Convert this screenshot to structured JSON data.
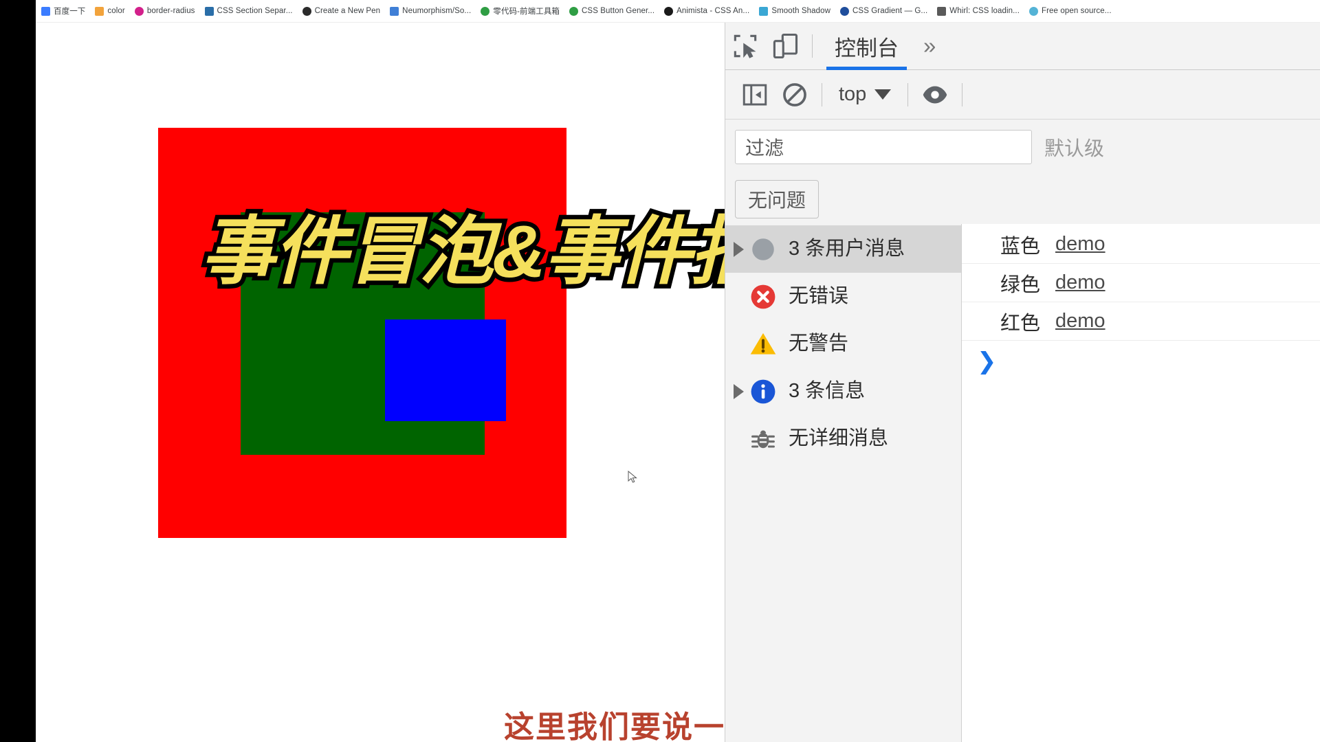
{
  "bookmarks": [
    {
      "label": "百度一下",
      "icon": "baidu-favicon",
      "color": "#3b7cff"
    },
    {
      "label": "color",
      "icon": "color-favicon",
      "color": "#f2a33c"
    },
    {
      "label": "border-radius",
      "icon": "border-radius-favicon",
      "color": "#d3208b"
    },
    {
      "label": "CSS Section Separ...",
      "icon": "css-section-favicon",
      "color": "#2a6ea8"
    },
    {
      "label": "Create a New Pen",
      "icon": "codepen-favicon",
      "color": "#2b2b2b"
    },
    {
      "label": "Neumorphism/So...",
      "icon": "neumorphism-favicon",
      "color": "#3f7fd6"
    },
    {
      "label": "零代码-前端工具箱",
      "icon": "globe-favicon",
      "color": "#2f9e44"
    },
    {
      "label": "CSS Button Gener...",
      "icon": "globe-favicon",
      "color": "#2f9e44"
    },
    {
      "label": "Animista - CSS An...",
      "icon": "animista-favicon",
      "color": "#1a1a1a"
    },
    {
      "label": "Smooth Shadow",
      "icon": "shadow-favicon",
      "color": "#3aa7d4"
    },
    {
      "label": "CSS Gradient — G...",
      "icon": "gradient-favicon",
      "color": "#1f4e9c"
    },
    {
      "label": "Whirl: CSS loadin...",
      "icon": "whirl-favicon",
      "color": "#5a5a5a"
    },
    {
      "label": "Free open source...",
      "icon": "cloud-favicon",
      "color": "#54b3d6"
    }
  ],
  "page": {
    "title_overlay": "事件冒泡&事件捕获",
    "caption": "这里我们要说一下事件流",
    "boxes": {
      "outer_color": "#ff0000",
      "middle_color": "#006400",
      "inner_color": "#0000ff"
    }
  },
  "devtools": {
    "tabs": {
      "inspect_icon": "inspect-element-icon",
      "device_icon": "device-toolbar-icon",
      "console_label": "控制台",
      "more_label": "»"
    },
    "toolbar": {
      "sidebar_toggle_icon": "console-sidebar-toggle-icon",
      "clear_icon": "clear-console-icon",
      "context_label": "top",
      "eye_icon": "live-expression-icon"
    },
    "filter": {
      "placeholder": "过滤",
      "value": "过滤",
      "levels_label": "默认级"
    },
    "issues": {
      "button_label": "无问题"
    },
    "sidebar_items": [
      {
        "label": "3 条用户消息",
        "icon": "user-message-icon",
        "expandable": true,
        "selected": true
      },
      {
        "label": "无错误",
        "icon": "error-icon",
        "expandable": false,
        "selected": false
      },
      {
        "label": "无警告",
        "icon": "warning-icon",
        "expandable": false,
        "selected": false
      },
      {
        "label": "3 条信息",
        "icon": "info-icon",
        "expandable": true,
        "selected": false
      },
      {
        "label": "无详细消息",
        "icon": "verbose-bug-icon",
        "expandable": false,
        "selected": false
      }
    ],
    "messages": [
      {
        "text": "蓝色",
        "source": "demo"
      },
      {
        "text": "绿色",
        "source": "demo"
      },
      {
        "text": "红色",
        "source": "demo"
      }
    ],
    "prompt_symbol": "❯"
  }
}
